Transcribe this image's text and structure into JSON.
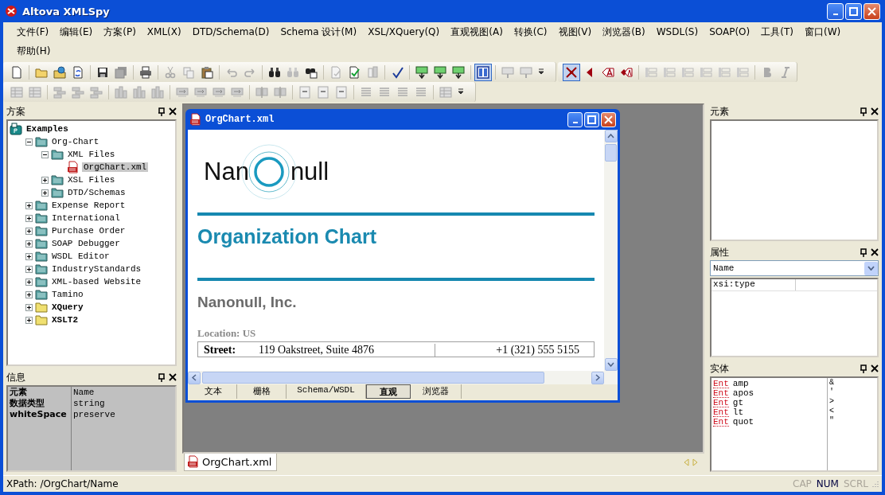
{
  "window": {
    "title": "Altova XMLSpy"
  },
  "menu": {
    "rows": [
      [
        {
          "label": "文件(F)"
        },
        {
          "label": "编辑(E)"
        },
        {
          "label": "方案(P)"
        },
        {
          "label": "XML(X)"
        },
        {
          "label": "DTD/Schema(D)"
        },
        {
          "label": "Schema 设计(M)"
        },
        {
          "label": "XSL/XQuery(Q)"
        },
        {
          "label": "直观视图(A)"
        },
        {
          "label": "转换(C)"
        },
        {
          "label": "视图(V)"
        },
        {
          "label": "浏览器(B)"
        },
        {
          "label": "WSDL(S)"
        },
        {
          "label": "SOAP(O)"
        },
        {
          "label": "工具(T)"
        },
        {
          "label": "窗口(W)"
        }
      ],
      [
        {
          "label": "帮助(H)"
        }
      ]
    ]
  },
  "project_panel": {
    "title": "方案",
    "tree": [
      {
        "label": "Examples",
        "kind": "project",
        "selected": false,
        "children": [
          {
            "label": "Org-Chart",
            "kind": "folder",
            "expanded": true,
            "selected": false,
            "children": [
              {
                "label": "XML Files",
                "kind": "folder",
                "expanded": true,
                "selected": false,
                "children": [
                  {
                    "label": "OrgChart.xml",
                    "kind": "file",
                    "selected": true
                  }
                ]
              },
              {
                "label": "XSL Files",
                "kind": "folder",
                "expanded": false,
                "selected": false
              },
              {
                "label": "DTD/Schemas",
                "kind": "folder",
                "expanded": false,
                "selected": false
              }
            ]
          },
          {
            "label": "Expense Report",
            "kind": "folder",
            "expanded": false,
            "selected": false
          },
          {
            "label": "International",
            "kind": "folder",
            "expanded": false,
            "selected": false
          },
          {
            "label": "Purchase Order",
            "kind": "folder",
            "expanded": false,
            "selected": false
          },
          {
            "label": "SOAP Debugger",
            "kind": "folder",
            "expanded": false,
            "selected": false
          },
          {
            "label": "WSDL Editor",
            "kind": "folder",
            "expanded": false,
            "selected": false
          },
          {
            "label": "IndustryStandards",
            "kind": "folder",
            "expanded": false,
            "selected": false
          },
          {
            "label": "XML-based Website",
            "kind": "folder",
            "expanded": false,
            "selected": false
          },
          {
            "label": "Tamino",
            "kind": "folder",
            "expanded": false,
            "selected": false
          },
          {
            "label": "XQuery",
            "kind": "external",
            "expanded": false,
            "selected": false
          },
          {
            "label": "XSLT2",
            "kind": "external",
            "expanded": false,
            "selected": false
          }
        ]
      }
    ]
  },
  "info_panel": {
    "title": "信息",
    "rows": [
      {
        "key": "元素",
        "value": "Name"
      },
      {
        "key": "数据类型",
        "value": "string"
      },
      {
        "key": "whiteSpace",
        "value": "preserve"
      }
    ]
  },
  "document": {
    "title": "OrgChart.xml",
    "logo": {
      "left": "Nan",
      "right": "null"
    },
    "heading": "Organization Chart",
    "company": "Nanonull, Inc.",
    "location": "Location: US",
    "address_row": {
      "label": "Street:",
      "value": "119 Oakstreet, Suite 4876",
      "phone": "+1 (321) 555 5155"
    },
    "view_tabs": [
      {
        "label": "文本",
        "selected": false
      },
      {
        "label": "栅格",
        "selected": false
      },
      {
        "label": "Schema/WSDL",
        "selected": false
      },
      {
        "label": "直观",
        "selected": true
      },
      {
        "label": "浏览器",
        "selected": false
      }
    ]
  },
  "document_tabs": [
    {
      "label": "OrgChart.xml",
      "selected": true
    }
  ],
  "elements_panel": {
    "title": "元素"
  },
  "attributes_panel": {
    "title": "属性",
    "selector": "Name",
    "rows": [
      {
        "name": "xsi:type"
      }
    ]
  },
  "entities_panel": {
    "title": "实体",
    "rows": [
      {
        "tag": "Ent",
        "name": "amp",
        "char": "&"
      },
      {
        "tag": "Ent",
        "name": "apos",
        "char": "'"
      },
      {
        "tag": "Ent",
        "name": "gt",
        "char": ">"
      },
      {
        "tag": "Ent",
        "name": "lt",
        "char": "<"
      },
      {
        "tag": "Ent",
        "name": "quot",
        "char": "\""
      }
    ]
  },
  "status_bar": {
    "text": "XPath: /OrgChart/Name",
    "indicators": [
      {
        "label": "CAP",
        "on": false
      },
      {
        "label": "NUM",
        "on": true
      },
      {
        "label": "SCRL",
        "on": false
      }
    ]
  }
}
